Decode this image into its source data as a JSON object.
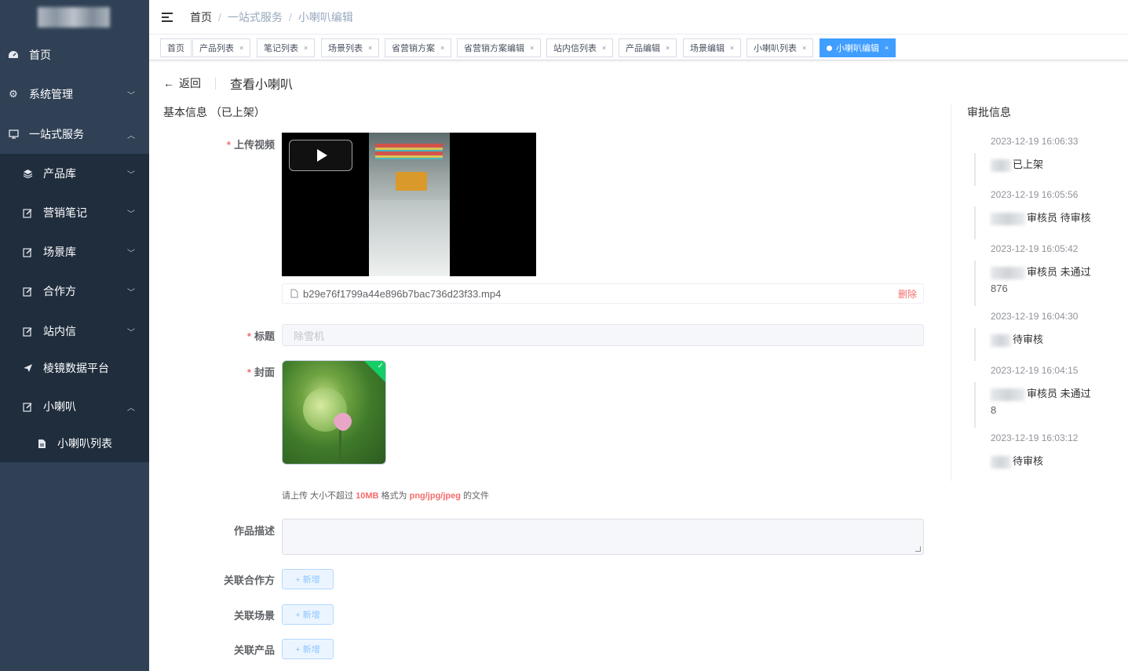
{
  "sidebar": {
    "items": [
      {
        "label": "首页",
        "icon": "dashboard-icon"
      },
      {
        "label": "系统管理",
        "icon": "gear-icon"
      },
      {
        "label": "一站式服务",
        "icon": "monitor-icon"
      },
      {
        "label": "产品库",
        "icon": "layers-icon"
      },
      {
        "label": "营销笔记",
        "icon": "edit-icon"
      },
      {
        "label": "场景库",
        "icon": "edit-icon"
      },
      {
        "label": "合作方",
        "icon": "edit-icon"
      },
      {
        "label": "站内信",
        "icon": "edit-icon"
      },
      {
        "label": "棱镜数据平台",
        "icon": "send-icon"
      },
      {
        "label": "小喇叭",
        "icon": "edit-icon"
      },
      {
        "label": "小喇叭列表",
        "icon": "document-icon"
      }
    ]
  },
  "breadcrumb": {
    "home": "首页",
    "level1": "一站式服务",
    "level2": "小喇叭编辑",
    "sep": "/"
  },
  "tags": [
    {
      "label": "首页"
    },
    {
      "label": "产品列表"
    },
    {
      "label": "笔记列表"
    },
    {
      "label": "场景列表"
    },
    {
      "label": "省营销方案"
    },
    {
      "label": "省营销方案编辑"
    },
    {
      "label": "站内信列表"
    },
    {
      "label": "产品编辑"
    },
    {
      "label": "场景编辑"
    },
    {
      "label": "小喇叭列表"
    },
    {
      "label": "小喇叭编辑",
      "active": true
    }
  ],
  "page": {
    "back_label": "返回",
    "title": "查看小喇叭",
    "section": "基本信息 （已上架）"
  },
  "form": {
    "video_label": "上传视频",
    "file_name": "b29e76f1799a44e896b7bac736d23f33.mp4",
    "delete_label": "删除",
    "title_label": "标题",
    "title_value": "除雪机",
    "cover_label": "封面",
    "tip_prefix": "请上传 大小不超过 ",
    "tip_size": "10MB",
    "tip_mid": " 格式为 ",
    "tip_format": "png/jpg/jpeg",
    "tip_suffix": " 的文件",
    "desc_label": "作品描述",
    "partner_label": "关联合作方",
    "scene_label": "关联场景",
    "product_label": "关联产品",
    "add_label": "+ 新增"
  },
  "approval": {
    "title": "审批信息",
    "entries": [
      {
        "time": "2023-12-19 16:06:33",
        "text": "已上架",
        "extra": ""
      },
      {
        "time": "2023-12-19 16:05:56",
        "text": "审核员 待审核",
        "extra": ""
      },
      {
        "time": "2023-12-19 16:05:42",
        "text": "审核员 未通过",
        "extra": "876"
      },
      {
        "time": "2023-12-19 16:04:30",
        "text": "待审核",
        "extra": ""
      },
      {
        "time": "2023-12-19 16:04:15",
        "text": "审核员 未通过",
        "extra": "8"
      },
      {
        "time": "2023-12-19 16:03:12",
        "text": "待审核",
        "extra": ""
      }
    ]
  }
}
